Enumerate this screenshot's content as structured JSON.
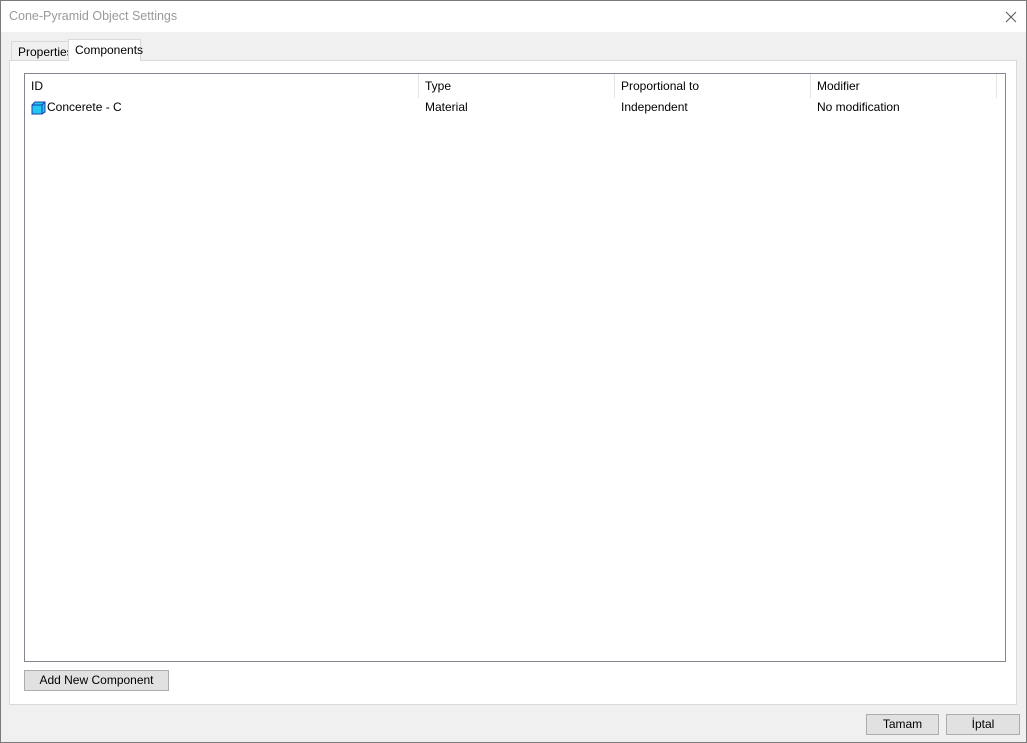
{
  "window": {
    "title": "Cone-Pyramid Object Settings",
    "close_icon": "close-icon"
  },
  "tabs": [
    {
      "label": "Properties",
      "selected": false
    },
    {
      "label": "Components",
      "selected": true
    }
  ],
  "components_list": {
    "columns": [
      "ID",
      "Type",
      "Proportional to",
      "Modifier"
    ],
    "rows": [
      {
        "icon": "material-cube-icon",
        "id": "Concerete - C",
        "type": "Material",
        "proportional_to": "Independent",
        "modifier": "No modification"
      }
    ]
  },
  "buttons": {
    "add_new_component": "Add New Component",
    "ok": "Tamam",
    "cancel": "İptal"
  },
  "colors": {
    "icon_fill": "#22c8f0",
    "icon_stroke": "#1a3fb0"
  }
}
